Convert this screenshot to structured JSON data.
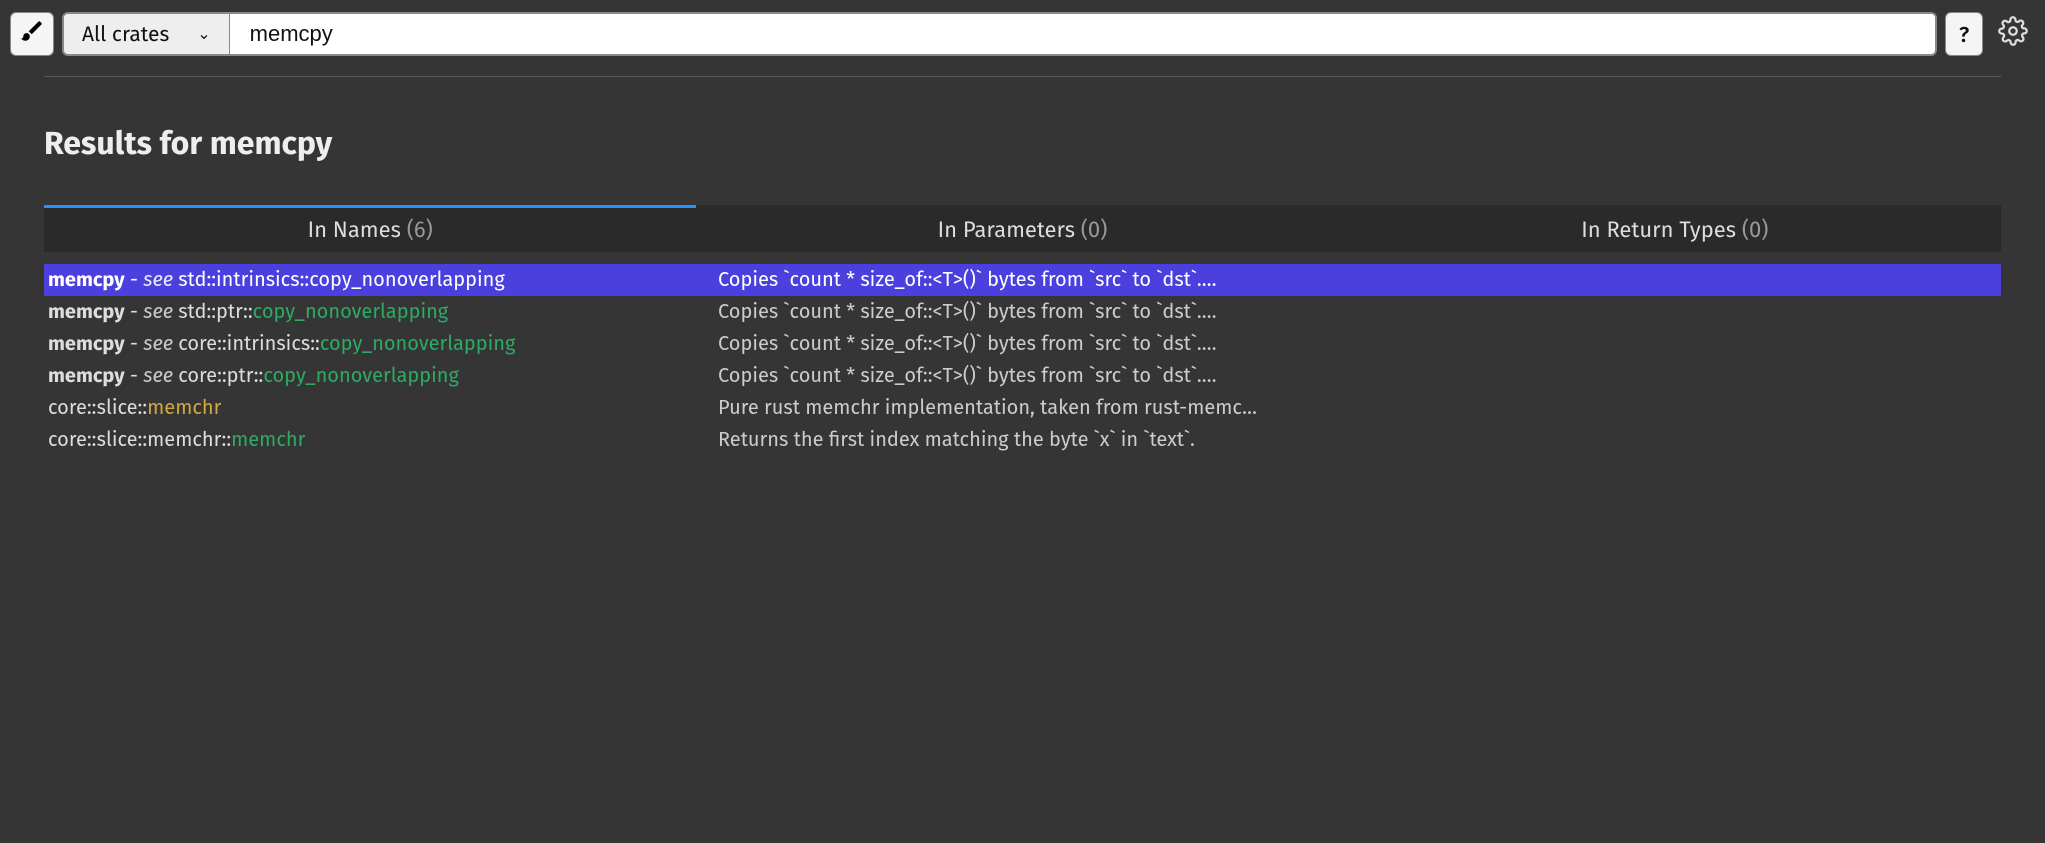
{
  "topbar": {
    "crate_select": "All crates",
    "search_value": "memcpy",
    "help_label": "?"
  },
  "heading": "Results for memcpy",
  "tabs": [
    {
      "label": "In Names",
      "count": "(6)",
      "active": true
    },
    {
      "label": "In Parameters",
      "count": "(0)",
      "active": false
    },
    {
      "label": "In Return Types",
      "count": "(0)",
      "active": false
    }
  ],
  "results": [
    {
      "selected": true,
      "kw": "memcpy",
      "sep": " - ",
      "see": "see ",
      "path": "std::intrinsics::",
      "target": "copy_nonoverlapping",
      "target_kind": "plain",
      "desc": "Copies `count * size_of::<T>()` bytes from `src` to `dst`.…"
    },
    {
      "selected": false,
      "kw": "memcpy",
      "sep": " - ",
      "see": "see ",
      "path": "std::ptr::",
      "target": "copy_nonoverlapping",
      "target_kind": "fn",
      "desc": "Copies `count * size_of::<T>()` bytes from `src` to `dst`.…"
    },
    {
      "selected": false,
      "kw": "memcpy",
      "sep": " - ",
      "see": "see ",
      "path": "core::intrinsics::",
      "target": "copy_nonoverlapping",
      "target_kind": "fn",
      "desc": "Copies `count * size_of::<T>()` bytes from `src` to `dst`.…"
    },
    {
      "selected": false,
      "kw": "memcpy",
      "sep": " - ",
      "see": "see ",
      "path": "core::ptr::",
      "target": "copy_nonoverlapping",
      "target_kind": "fn",
      "desc": "Copies `count * size_of::<T>()` bytes from `src` to `dst`.…"
    },
    {
      "selected": false,
      "kw": "",
      "sep": "",
      "see": "",
      "path": "core::slice::",
      "target": "memchr",
      "target_kind": "mod",
      "desc": "Pure rust memchr implementation, taken from rust-memc…"
    },
    {
      "selected": false,
      "kw": "",
      "sep": "",
      "see": "",
      "path": "core::slice::memchr::",
      "target": "memchr",
      "target_kind": "fn",
      "desc": "Returns the first index matching the byte `x` in `text`."
    }
  ]
}
